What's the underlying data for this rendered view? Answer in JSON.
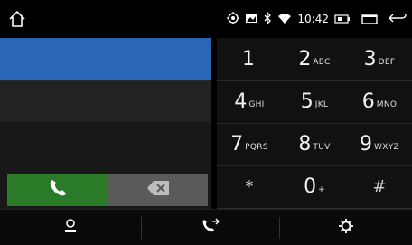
{
  "statusbar": {
    "time": "10:42",
    "icons": [
      "location-icon",
      "image-icon",
      "bluetooth-icon",
      "wifi-icon",
      "battery-icon",
      "window-icon",
      "back-icon"
    ]
  },
  "dialer": {
    "number_field": "",
    "keys": [
      {
        "digit": "1",
        "letters": ""
      },
      {
        "digit": "2",
        "letters": "ABC"
      },
      {
        "digit": "3",
        "letters": "DEF"
      },
      {
        "digit": "4",
        "letters": "GHI"
      },
      {
        "digit": "5",
        "letters": "JKL"
      },
      {
        "digit": "6",
        "letters": "MNO"
      },
      {
        "digit": "7",
        "letters": "PQRS"
      },
      {
        "digit": "8",
        "letters": "TUV"
      },
      {
        "digit": "9",
        "letters": "WXYZ"
      },
      {
        "digit": "*",
        "letters": ""
      },
      {
        "digit": "0",
        "letters": "+"
      },
      {
        "digit": "#",
        "letters": ""
      }
    ]
  },
  "buttons": {
    "call": "call-icon",
    "delete": "backspace-icon"
  },
  "bottom_tabs": [
    "contacts-icon",
    "call-log-icon",
    "settings-icon"
  ],
  "colors": {
    "number_bar": "#2b66b6",
    "call_button": "#2a7a28",
    "delete_button": "#5a5a5a"
  }
}
